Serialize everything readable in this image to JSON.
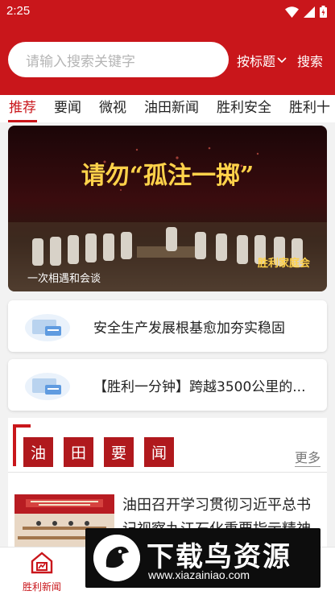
{
  "status": {
    "time": "2:25"
  },
  "search": {
    "placeholder": "请输入搜索关键字",
    "sort_label": "按标题",
    "search_label": "搜索"
  },
  "tabs": [
    {
      "label": "推荐",
      "active": true
    },
    {
      "label": "要闻"
    },
    {
      "label": "微视"
    },
    {
      "label": "油田新闻"
    },
    {
      "label": "胜利安全"
    },
    {
      "label": "胜利十"
    }
  ],
  "banner": {
    "caption": "一次相遇和会谈",
    "title_text": "请勿“孤注一掷”",
    "logo_text": "胜利家庭会"
  },
  "news": [
    {
      "title": "安全生产发展根基愈加夯实稳固"
    },
    {
      "title": "【胜利一分钟】跨越3500公里的..."
    }
  ],
  "section": {
    "chars": [
      "油",
      "田",
      "要",
      "闻"
    ],
    "more_label": "更多",
    "article_title": "油田召开学习贯彻习近平总书记视察九江石化重要指示精神"
  },
  "bottom_nav": {
    "item_label": "胜利新闻"
  },
  "watermark": {
    "title": "下载鸟资源",
    "url": "www.xiazainiao.com"
  },
  "colors": {
    "brand_red": "#c9161b",
    "section_red": "#b0191d"
  }
}
